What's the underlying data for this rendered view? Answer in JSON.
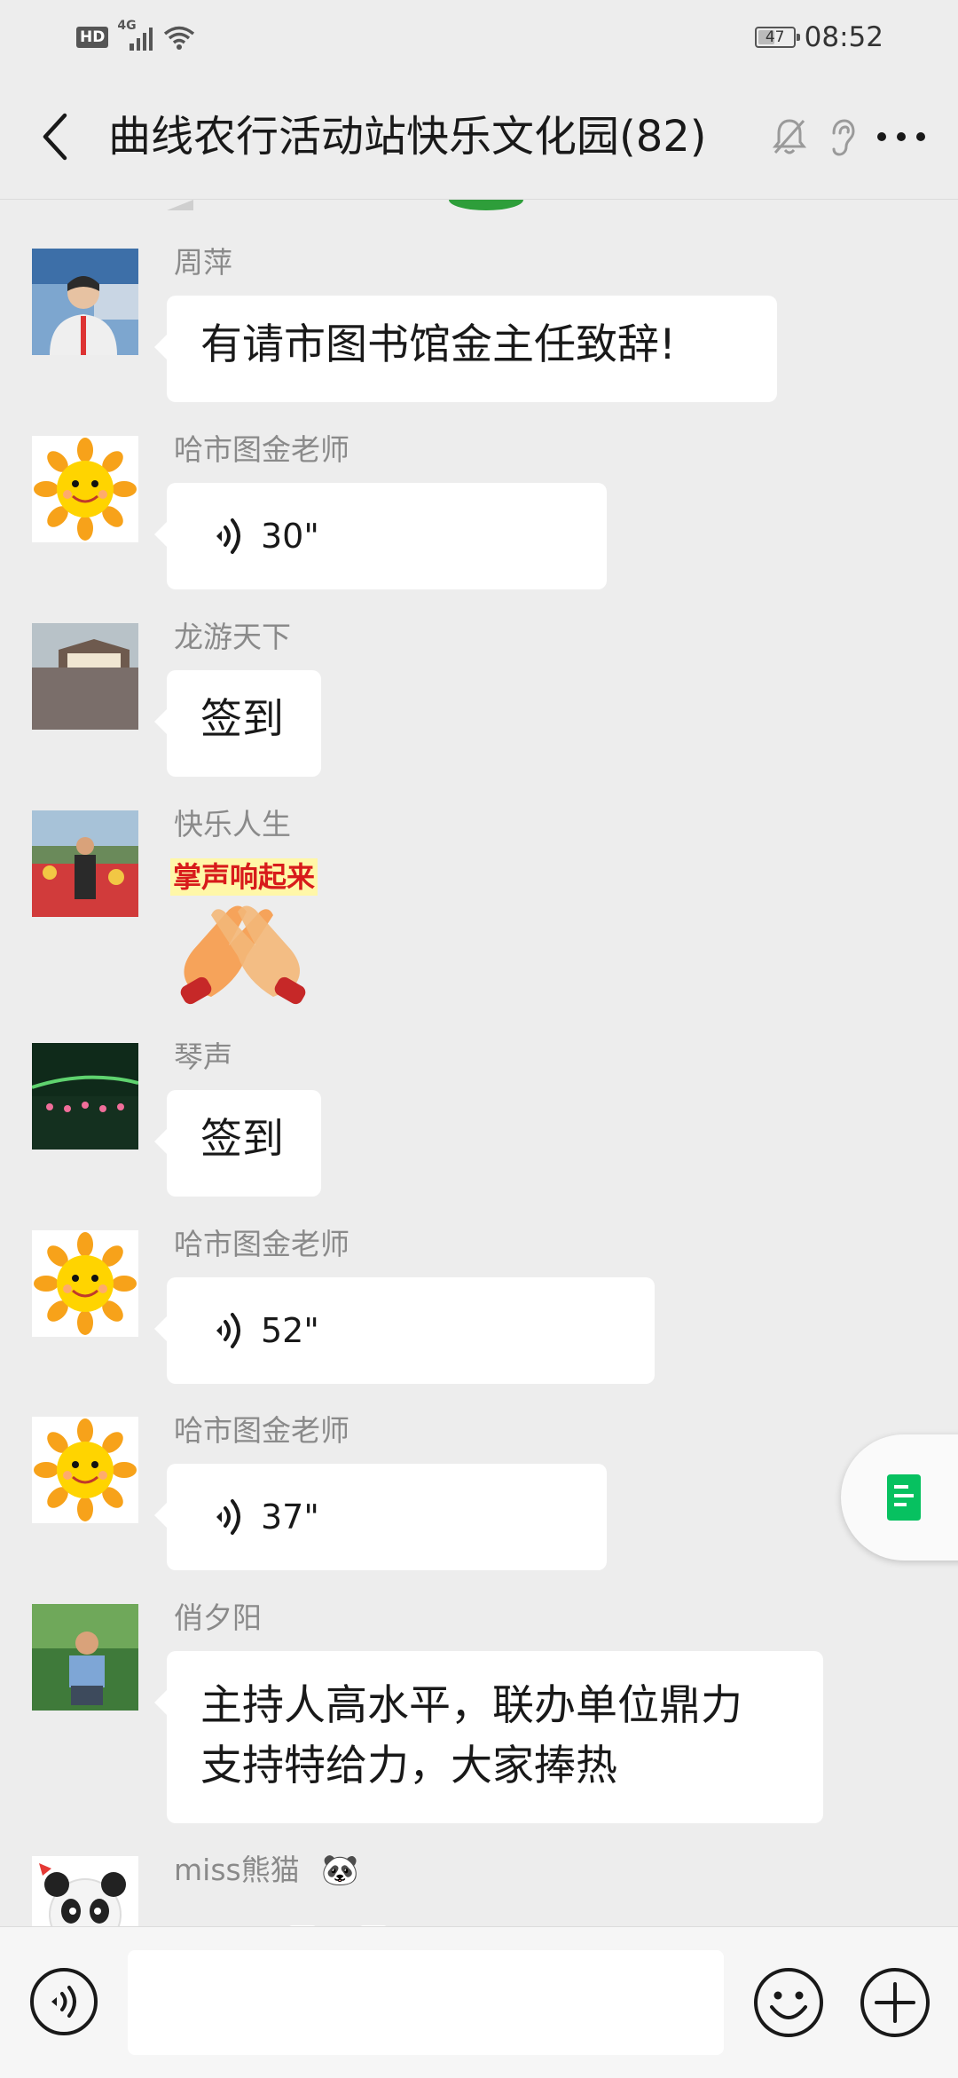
{
  "status_bar": {
    "network_badge": "HD",
    "network_type": "4G",
    "battery_level": "47",
    "battery_fraction": 0.47,
    "time": "08:52"
  },
  "header": {
    "title": "曲线农行活动站快乐文化园(82)",
    "icons": [
      "back-icon",
      "mute-bell-icon",
      "ear-icon",
      "more-icon"
    ]
  },
  "messages": [
    {
      "sender": "周萍",
      "type": "text",
      "text": "有请市图书馆金主任致辞!"
    },
    {
      "sender": "哈市图金老师",
      "type": "voice",
      "duration": "30\""
    },
    {
      "sender": "龙游天下",
      "type": "text",
      "text": "签到"
    },
    {
      "sender": "快乐人生",
      "type": "sticker",
      "sticker_text": "掌声响起来"
    },
    {
      "sender": "琴声",
      "type": "text",
      "text": "签到"
    },
    {
      "sender": "哈市图金老师",
      "type": "voice",
      "duration": "52\""
    },
    {
      "sender": "哈市图金老师",
      "type": "voice",
      "duration": "37\""
    },
    {
      "sender": "俏夕阳",
      "type": "text",
      "text_lines": [
        "主持人高水平，联办单位鼎力",
        "支持特给力，大家捧热"
      ]
    },
    {
      "sender": "miss熊猫",
      "type": "partial",
      "sender_emoji": "🐼"
    }
  ],
  "floating_button": {
    "icon": "note-icon"
  },
  "input_bar": {
    "placeholder": "",
    "icons": [
      "voice-toggle-icon",
      "emoji-icon",
      "plus-icon"
    ]
  },
  "colors": {
    "background": "#ededed",
    "bubble": "#ffffff",
    "sender_name": "#8a8a8a",
    "accent_green": "#07c160"
  }
}
